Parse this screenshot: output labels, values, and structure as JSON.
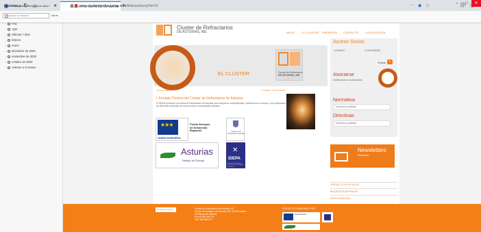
{
  "browser": {
    "tabs": [
      {
        "label": "Sobre cluster refractarios asturi"
      },
      {
        "label": "CLUSTER DE EMPRESAS DE MATERI"
      }
    ],
    "new_tab": "+",
    "window_controls": [
      "–",
      "□",
      "✕"
    ],
    "url_host": "www.clusterderefractarios.com",
    "url_path": "/Noticias/busq?id=10",
    "url_dots": "···",
    "library_icon": "|||\\",
    "sidebar_icon": "▢"
  },
  "sidebar": {
    "title": "Historial ∨",
    "close": "✕",
    "search_placeholder": "Buscar en historial",
    "view_button": "Ver ▾",
    "items": [
      {
        "label": "Hoy"
      },
      {
        "label": "Ayer"
      },
      {
        "label": "Últimos 7 días"
      },
      {
        "label": "febrero"
      },
      {
        "label": "enero"
      },
      {
        "label": "diciembre de 2020"
      },
      {
        "label": "noviembre de 2020"
      },
      {
        "label": "octubre de 2020"
      },
      {
        "label": "Anterior a 6 meses"
      }
    ]
  },
  "site": {
    "brand_line1": "Cluster de Refractarios",
    "brand_line2": "DE ASTURIAS, AIE",
    "menu": [
      "INICIO",
      "EL CLUSTER",
      "EMPRESAS",
      "CONTACTO",
      "LOCALIZACIÓN"
    ],
    "hero_title": "EL CLUSTER",
    "hero_subtitle_1": "Cluster de Refractarios",
    "hero_subtitle_2": "DE ASTURIAS, AIE",
    "breadcrumb_left": "ACTUALIDAD",
    "breadcrumb_right": "< VOLVER / ACTUALIDAD",
    "article_title": "I Jornada Técnica del Cluster de Refractarios de Asturias",
    "article_text": "El IDEPA presenta a la oferta de Refractarios de Asturias para mejorar la competitividad y eficiencia en el sector, y la cooperación de diferentes sistemas de mejora frente a necesidades Asturias.",
    "eu_label": "UNIÓN EUROPEA",
    "feder_text_1": "Fondo Europeo",
    "feder_text_2": "de Desarrollo",
    "feder_text_3": "Regional",
    "gob_text": "Gobierno del Principado de Asturias",
    "asturias_name": "Asturias",
    "asturias_sub": "Reflejo de Europa",
    "idepa_name": "IDEPA",
    "idepa_sub": "Instituto de Desarrollo Económico del Principado de Asturias"
  },
  "right": {
    "access_title": "Acceso Socios",
    "user_label": "USUARIO",
    "pass_label": "CONTRASEÑA",
    "enter": "Entrar",
    "enter_arrow": "»",
    "join_title": "Asociarse",
    "join_sub": "Solicita ahora tu incorporación",
    "normativa_title": "Normativa",
    "normativa_box": "Envíenos su solicitud",
    "directivas_title": "Directivas",
    "directivas_box": "Envíenos su solicitud",
    "newsletter_title": "Newsletters",
    "newsletter_sub": "Suscríbase",
    "links": [
      "CONTACTO CON SU SALUD",
      "BUZÓN DE SUGERENCIAS",
      "AVISO PRIVACIDAD"
    ]
  },
  "footer": {
    "logo_text": "Principado de Asturias",
    "address": [
      "Cluster de Refractarios de Asturias AIE",
      "Parque Tecnológico de Asturias S/N, 33428 Llanera",
      "Principado de Asturias",
      "Phone 985 980 076",
      "Fax: 985 980 079"
    ],
    "program_title": "PROYECTO FINANCIADO POR:"
  },
  "colors": {
    "accent": "#ef7c1a",
    "footer": "#f47f17",
    "dark_accent": "#c83a1a"
  }
}
